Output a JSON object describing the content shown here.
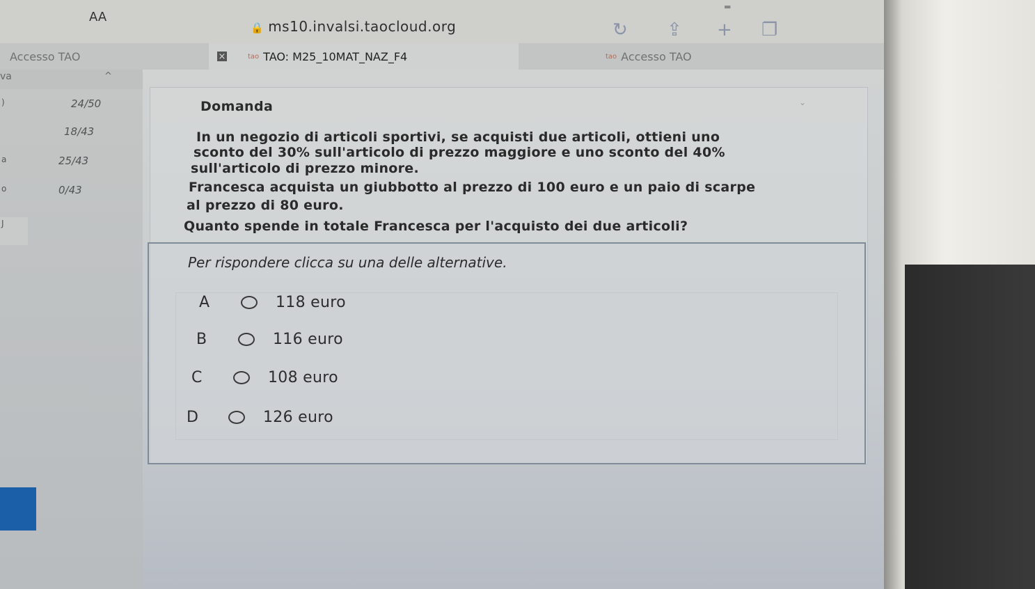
{
  "browser": {
    "text_size_button": "AA",
    "url": "ms10.invalsi.taocloud.org",
    "icons": [
      "reload-icon",
      "share-icon",
      "new-tab-icon",
      "tabs-icon"
    ]
  },
  "tabs": [
    {
      "label": "Accesso TAO",
      "active": false
    },
    {
      "label": "TAO: M25_10MAT_NAZ_F4",
      "active": true
    },
    {
      "label": "Accesso TAO",
      "active": false
    }
  ],
  "sidebar": {
    "header_label": "va",
    "scores": [
      "24/50",
      "18/43",
      "25/43",
      "0/43"
    ],
    "markers": [
      ")",
      "",
      "a",
      "o",
      "J"
    ]
  },
  "question": {
    "title": "Domanda",
    "lines": [
      "In un negozio di articoli sportivi, se acquisti due articoli, ottieni uno",
      "sconto del 30% sull'articolo di prezzo maggiore e uno sconto del 40%",
      "sull'articolo di prezzo minore.",
      "Francesca acquista un giubbotto al prezzo di 100 euro e un paio di scarpe",
      "al prezzo di 80 euro.",
      "Quanto spende in totale Francesca per l'acquisto dei due articoli?"
    ]
  },
  "answers": {
    "prompt": "Per rispondere clicca su una delle alternative.",
    "options": [
      {
        "letter": "A",
        "label": "118 euro"
      },
      {
        "letter": "B",
        "label": "116 euro"
      },
      {
        "letter": "C",
        "label": "108 euro"
      },
      {
        "letter": "D",
        "label": "126 euro"
      }
    ]
  },
  "colors": {
    "accent_blue": "#1a5fa8",
    "toolbar_icon": "#8a93a8"
  }
}
